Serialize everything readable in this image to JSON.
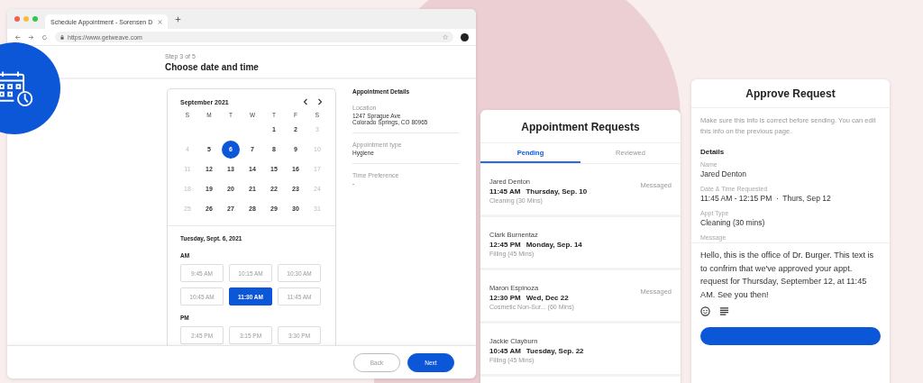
{
  "browser": {
    "tab_title": "Schedule Appointment - Sorensen D",
    "url": "https://www.getweave.com"
  },
  "page": {
    "step": "Step 3 of 5",
    "title": "Choose date and time"
  },
  "calendar": {
    "month": "September 2021",
    "weekdays": [
      "S",
      "M",
      "T",
      "W",
      "T",
      "F",
      "S"
    ],
    "weeks": [
      [
        {
          "label": "1",
          "muted": false,
          "selected": false
        },
        {
          "label": "2",
          "muted": false,
          "selected": false
        },
        {
          "label": "3",
          "muted": true,
          "selected": false
        }
      ],
      [
        {
          "label": "4",
          "muted": true,
          "selected": false
        },
        {
          "label": "5",
          "muted": false,
          "selected": false
        },
        {
          "label": "6",
          "muted": false,
          "selected": true
        },
        {
          "label": "7",
          "muted": false,
          "selected": false
        },
        {
          "label": "8",
          "muted": false,
          "selected": false
        },
        {
          "label": "9",
          "muted": false,
          "selected": false
        },
        {
          "label": "10",
          "muted": true,
          "selected": false
        }
      ],
      [
        {
          "label": "11",
          "muted": true,
          "selected": false
        },
        {
          "label": "12",
          "muted": false,
          "selected": false
        },
        {
          "label": "13",
          "muted": false,
          "selected": false
        },
        {
          "label": "14",
          "muted": false,
          "selected": false
        },
        {
          "label": "15",
          "muted": false,
          "selected": false
        },
        {
          "label": "16",
          "muted": false,
          "selected": false
        },
        {
          "label": "17",
          "muted": true,
          "selected": false
        }
      ],
      [
        {
          "label": "18",
          "muted": true,
          "selected": false
        },
        {
          "label": "19",
          "muted": false,
          "selected": false
        },
        {
          "label": "20",
          "muted": false,
          "selected": false
        },
        {
          "label": "21",
          "muted": false,
          "selected": false
        },
        {
          "label": "22",
          "muted": false,
          "selected": false
        },
        {
          "label": "23",
          "muted": false,
          "selected": false
        },
        {
          "label": "24",
          "muted": true,
          "selected": false
        }
      ],
      [
        {
          "label": "25",
          "muted": true,
          "selected": false
        },
        {
          "label": "26",
          "muted": false,
          "selected": false
        },
        {
          "label": "27",
          "muted": false,
          "selected": false
        },
        {
          "label": "28",
          "muted": false,
          "selected": false
        },
        {
          "label": "29",
          "muted": false,
          "selected": false
        },
        {
          "label": "30",
          "muted": false,
          "selected": false
        },
        {
          "label": "31",
          "muted": true,
          "selected": false
        }
      ]
    ],
    "selected_date": "Tuesday, Sept. 6, 2021",
    "periods": [
      {
        "label": "AM",
        "slots": [
          {
            "label": "9:45 AM",
            "selected": false
          },
          {
            "label": "10:15 AM",
            "selected": false
          },
          {
            "label": "10:30 AM",
            "selected": false
          },
          {
            "label": "10:45 AM",
            "selected": false
          },
          {
            "label": "11:30 AM",
            "selected": true
          },
          {
            "label": "11:45 AM",
            "selected": false
          }
        ]
      },
      {
        "label": "PM",
        "slots": [
          {
            "label": "2:45 PM",
            "selected": false
          },
          {
            "label": "3:15 PM",
            "selected": false
          },
          {
            "label": "3:30 PM",
            "selected": false
          }
        ]
      }
    ]
  },
  "details": {
    "title": "Appointment Details",
    "fields": [
      {
        "label": "Location",
        "lines": [
          "1247 Sprague Ave",
          "Colorado Springs, CO 80965"
        ]
      },
      {
        "label": "Appointment type",
        "lines": [
          "Hygiene"
        ]
      },
      {
        "label": "Time Preference",
        "lines": [
          "-"
        ]
      }
    ]
  },
  "footer_buttons": [
    {
      "label": "Back",
      "kind": "secondary"
    },
    {
      "label": "Next",
      "kind": "primary"
    }
  ],
  "requests": {
    "title": "Appointment Requests",
    "tabs": [
      {
        "label": "Pending",
        "selected": true
      },
      {
        "label": "Reviewed",
        "selected": false
      }
    ],
    "items": [
      {
        "name": "Jared Denton",
        "time": "11:45 AM",
        "date": "Thursday, Sep. 10",
        "type": "Cleaning (30 Mins)",
        "status": "Messaged"
      },
      {
        "name": "Clark Burnentaz",
        "time": "12:45 PM",
        "date": "Monday, Sep. 14",
        "type": "Filling (45 Mins)"
      },
      {
        "name": "Maron Espinoza",
        "time": "12:30 PM",
        "date": "Wed, Dec 22",
        "type": "Cosmetic Non-Sur... (60 Mins)",
        "status": "Messaged"
      },
      {
        "name": "Jackie Clayburn",
        "time": "10:45 AM",
        "date": "Tuesday, Sep. 22",
        "type": "Filling (45 Mins)"
      }
    ]
  },
  "approve": {
    "title": "Approve Request",
    "intro": "Make sure this info is correct before sending. You can edit this info on the previous page.",
    "section": "Details",
    "fields": [
      {
        "label": "Name",
        "value": "Jared Denton"
      },
      {
        "label": "Date & Time Requested",
        "value": "11:45 AM - 12:15 PM  ·  Thurs, Sep 12"
      },
      {
        "label": "Appt Type",
        "value": "Cleaning (30 mins)"
      }
    ],
    "message_label": "Message",
    "message": "Hello, this is the office of Dr. Burger. This text is to confrim that we've approved your appt. request for Thursday, September 12, at 11:45 AM. See you then!"
  }
}
